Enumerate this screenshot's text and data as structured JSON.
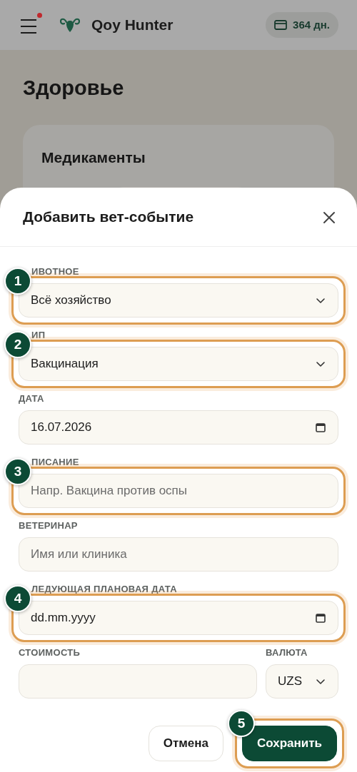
{
  "header": {
    "menu_notification": true,
    "app_name": "Qoy Hunter",
    "subscription": "364 дн."
  },
  "page": {
    "title": "Здоровье",
    "card_title": "Медикаменты"
  },
  "dialog": {
    "title": "Добавить вет-событие",
    "fields": [
      {
        "kind": "select",
        "label": "ИВОТНОЕ",
        "value": "Всё хозяйство",
        "highlighted": true,
        "step": "1"
      },
      {
        "kind": "select",
        "label": "ИП",
        "value": "Вакцинация",
        "highlighted": true,
        "step": "2"
      },
      {
        "kind": "date",
        "label": "ДАТА",
        "value": "16.07.2026"
      },
      {
        "kind": "text",
        "label": "ПИСАНИЕ",
        "placeholder": "Напр. Вакцина против оспы",
        "highlighted": true,
        "step": "3"
      },
      {
        "kind": "text",
        "label": "ВЕТЕРИНАР",
        "placeholder": "Имя или клиника"
      },
      {
        "kind": "date",
        "label": "ЛЕДУЮЩАЯ ПЛАНОВАЯ ДАТА",
        "placeholder": "dd.mm.yyyy",
        "highlighted": true,
        "step": "4"
      }
    ],
    "cost_row": [
      {
        "kind": "text",
        "label": "СТОИМОСТЬ"
      },
      {
        "kind": "select",
        "label": "ВАЛЮТА",
        "value": "UZS"
      }
    ],
    "buttons": [
      {
        "kind": "secondary",
        "label": "Отмена"
      },
      {
        "kind": "primary",
        "label": "Сохранить",
        "highlighted": true,
        "step": "5"
      }
    ]
  }
}
